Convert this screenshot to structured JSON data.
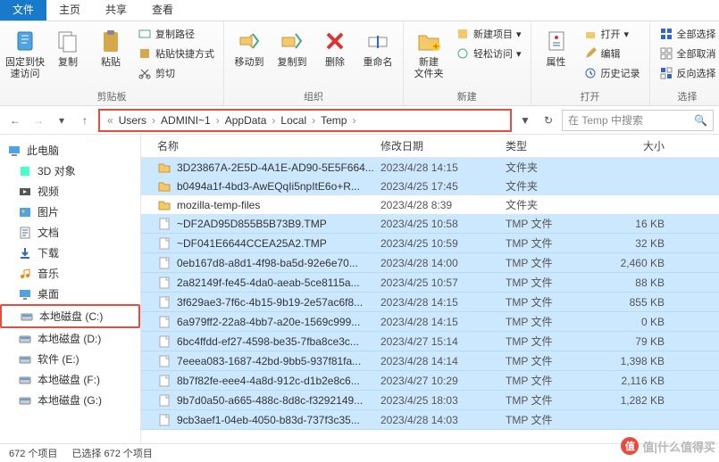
{
  "tabs": {
    "file": "文件",
    "home": "主页",
    "share": "共享",
    "view": "查看"
  },
  "ribbon": {
    "clipboard": {
      "label": "剪贴板",
      "pin": "固定到快\n速访问",
      "copy": "复制",
      "paste": "粘贴",
      "copy_path": "复制路径",
      "paste_shortcut": "粘贴快捷方式",
      "cut": "剪切"
    },
    "organize": {
      "label": "组织",
      "move_to": "移动到",
      "copy_to": "复制到",
      "delete": "删除",
      "rename": "重命名"
    },
    "new": {
      "label": "新建",
      "new_folder": "新建\n文件夹",
      "new_item": "新建项目",
      "easy_access": "轻松访问"
    },
    "open": {
      "label": "打开",
      "properties": "属性",
      "open": "打开",
      "edit": "编辑",
      "history": "历史记录"
    },
    "select": {
      "label": "选择",
      "select_all": "全部选择",
      "select_none": "全部取消",
      "invert": "反向选择"
    }
  },
  "breadcrumb": [
    "Users",
    "ADMINI~1",
    "AppData",
    "Local",
    "Temp"
  ],
  "search": {
    "placeholder": "在 Temp 中搜索"
  },
  "columns": {
    "name": "名称",
    "date": "修改日期",
    "type": "类型",
    "size": "大小"
  },
  "type_labels": {
    "folder": "文件夹",
    "tmp": "TMP 文件"
  },
  "sidebar": {
    "this_pc": "此电脑",
    "items": [
      {
        "label": "3D 对象",
        "icon": "cube"
      },
      {
        "label": "视频",
        "icon": "video"
      },
      {
        "label": "图片",
        "icon": "image"
      },
      {
        "label": "文档",
        "icon": "doc"
      },
      {
        "label": "下载",
        "icon": "download"
      },
      {
        "label": "音乐",
        "icon": "music"
      },
      {
        "label": "桌面",
        "icon": "desktop"
      },
      {
        "label": "本地磁盘 (C:)",
        "icon": "disk",
        "hl": true
      },
      {
        "label": "本地磁盘 (D:)",
        "icon": "disk"
      },
      {
        "label": "软件 (E:)",
        "icon": "disk"
      },
      {
        "label": "本地磁盘 (F:)",
        "icon": "disk"
      },
      {
        "label": "本地磁盘 (G:)",
        "icon": "disk"
      }
    ]
  },
  "files": [
    {
      "name": "3D23867A-2E5D-4A1E-AD90-5E5F664...",
      "date": "2023/4/28 14:15",
      "type": "folder",
      "size": "",
      "sel": true
    },
    {
      "name": "b0494a1f-4bd3-AwEQqIi5npItE6o+R...",
      "date": "2023/4/25 17:45",
      "type": "folder",
      "size": "",
      "sel": true
    },
    {
      "name": "mozilla-temp-files",
      "date": "2023/4/28 8:39",
      "type": "folder",
      "size": "",
      "sel": false
    },
    {
      "name": "~DF2AD95D855B5B73B9.TMP",
      "date": "2023/4/25 10:58",
      "type": "tmp",
      "size": "16 KB"
    },
    {
      "name": "~DF041E6644CCEA25A2.TMP",
      "date": "2023/4/25 10:59",
      "type": "tmp",
      "size": "32 KB"
    },
    {
      "name": "0eb167d8-a8d1-4f98-ba5d-92e6e70...",
      "date": "2023/4/28 14:00",
      "type": "tmp",
      "size": "2,460 KB"
    },
    {
      "name": "2a82149f-fe45-4da0-aeab-5ce8115a...",
      "date": "2023/4/25 10:57",
      "type": "tmp",
      "size": "88 KB"
    },
    {
      "name": "3f629ae3-7f6c-4b15-9b19-2e57ac6f8...",
      "date": "2023/4/28 14:15",
      "type": "tmp",
      "size": "855 KB"
    },
    {
      "name": "6a979ff2-22a8-4bb7-a20e-1569c999...",
      "date": "2023/4/28 14:15",
      "type": "tmp",
      "size": "0 KB"
    },
    {
      "name": "6bc4ffdd-ef27-4598-be35-7fba8ce3c...",
      "date": "2023/4/27 15:14",
      "type": "tmp",
      "size": "79 KB"
    },
    {
      "name": "7eeea083-1687-42bd-9bb5-937f81fa...",
      "date": "2023/4/28 14:14",
      "type": "tmp",
      "size": "1,398 KB"
    },
    {
      "name": "8b7f82fe-eee4-4a8d-912c-d1b2e8c6...",
      "date": "2023/4/27 10:29",
      "type": "tmp",
      "size": "2,116 KB"
    },
    {
      "name": "9b7d0a50-a665-488c-8d8c-f3292149...",
      "date": "2023/4/25 18:03",
      "type": "tmp",
      "size": "1,282 KB"
    },
    {
      "name": "9cb3aef1-04eb-4050-b83d-737f3c35...",
      "date": "2023/4/28 14:03",
      "type": "tmp",
      "size": ""
    }
  ],
  "status": {
    "count": "672 个项目",
    "selected": "已选择 672 个项目"
  },
  "watermark": "值|什么值得买"
}
